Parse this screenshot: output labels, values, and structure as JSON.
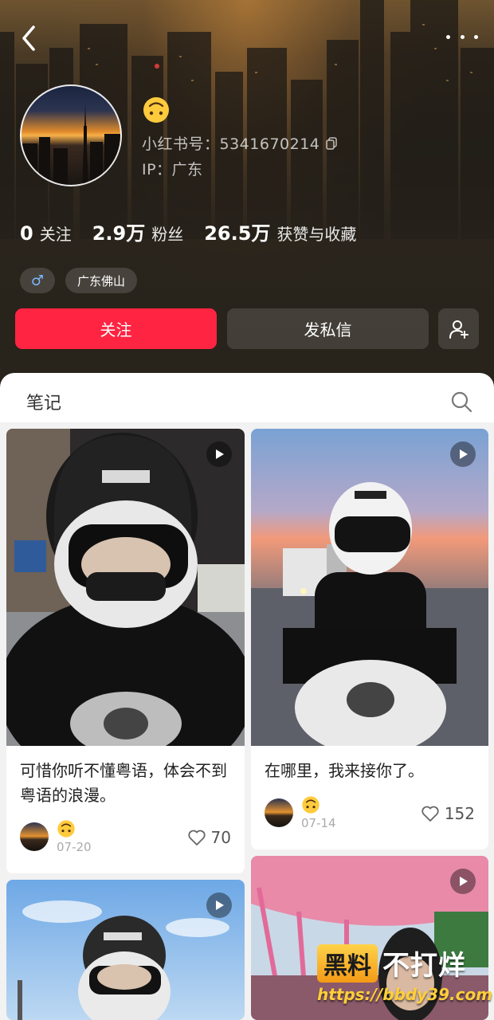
{
  "profile": {
    "avatar_emoji": "🙃",
    "id_label": "小红书号：5341670214",
    "ip_label": "IP：广东",
    "stats": [
      {
        "num": "0",
        "label": "关注"
      },
      {
        "num": "2.9万",
        "label": "粉丝"
      },
      {
        "num": "26.5万",
        "label": "获赞与收藏"
      }
    ],
    "tags": {
      "gender": "♂",
      "location": "广东佛山"
    },
    "buttons": {
      "follow": "关注",
      "message": "发私信"
    }
  },
  "tabs": {
    "notes": "笔记"
  },
  "icons": [
    "back-icon",
    "more-icon",
    "copy-icon",
    "add-user-icon",
    "search-icon",
    "play-icon",
    "heart-icon"
  ],
  "colors": {
    "accent": "#ff2442",
    "header_bg": "#28231b"
  },
  "notes": [
    {
      "title": "可惜你听不懂粤语，体会不到粤语的浪漫。",
      "emoji": "🙃",
      "date": "07-20",
      "likes": "70"
    },
    {
      "title": "在哪里，我来接你了。",
      "emoji": "🙃",
      "date": "07-14",
      "likes": "152"
    },
    {
      "title": "",
      "emoji": "",
      "date": "",
      "likes": ""
    },
    {
      "title": "",
      "emoji": "",
      "date": "",
      "likes": ""
    }
  ],
  "watermark": {
    "badge": "黑料",
    "text": "不打烊",
    "url": "https://bbdy39.com"
  }
}
